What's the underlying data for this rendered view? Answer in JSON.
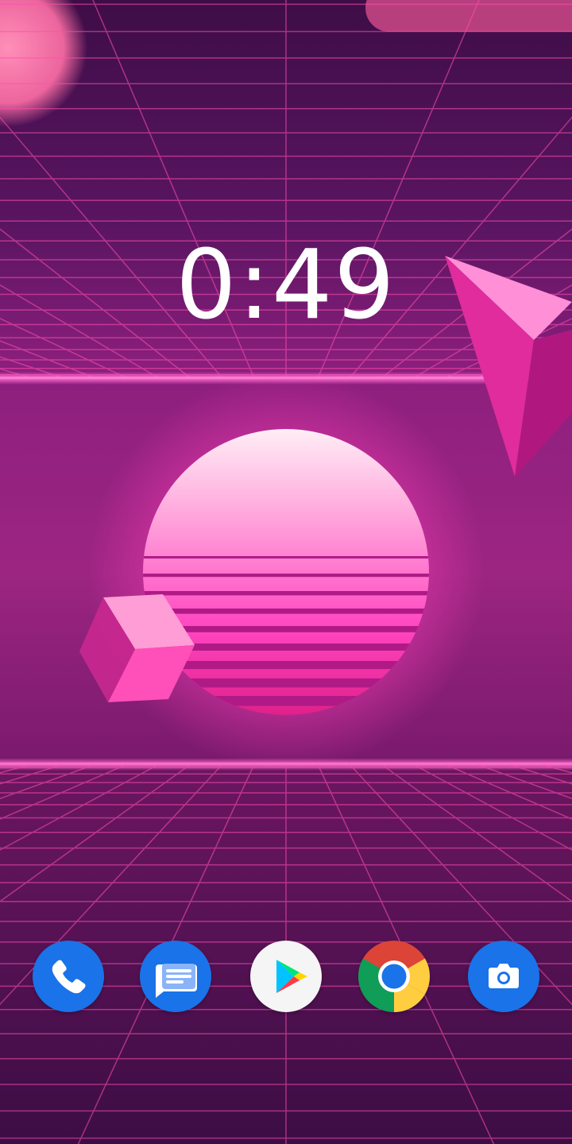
{
  "lock_screen": {
    "clock": "0:49"
  },
  "dock": {
    "apps": [
      {
        "name": "phone-icon",
        "color": "#1a73e8"
      },
      {
        "name": "messages-icon",
        "color": "#1a73e8"
      },
      {
        "name": "play-store-icon",
        "color": "#ffffff"
      },
      {
        "name": "chrome-icon",
        "color": "#db4437"
      },
      {
        "name": "camera-icon",
        "color": "#1a73e8"
      }
    ]
  },
  "wallpaper": {
    "theme": "synthwave-sun-grid",
    "colors": {
      "sky_top": "#4a0f52",
      "grid_line": "#ff4fb0",
      "horizon": "#ff5cc0",
      "sun_top": "#ffe6f2",
      "sun_bottom": "#ff2a9c"
    }
  }
}
